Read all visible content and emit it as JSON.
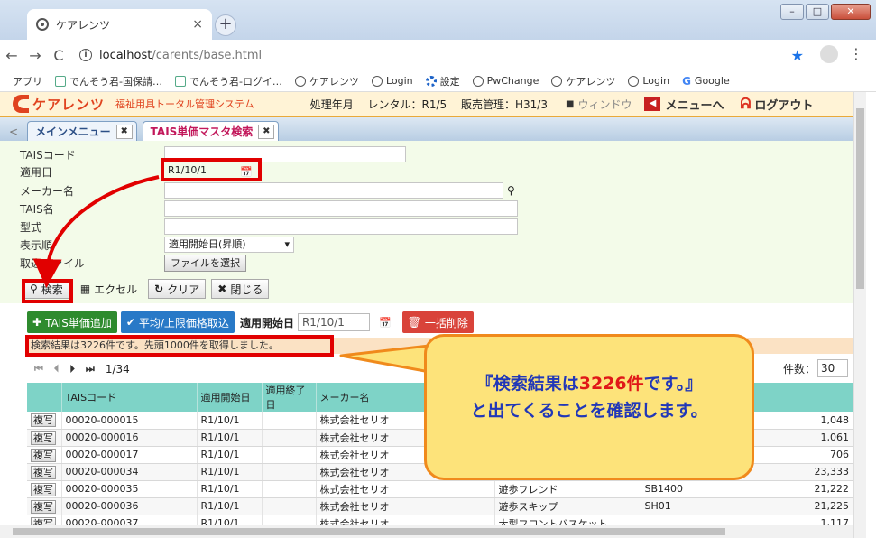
{
  "browser": {
    "tab_title": "ケアレンツ",
    "tab_close": "×",
    "new_tab": "+",
    "url_host": "localhost",
    "url_path": "/carents/base.html",
    "info_glyph": "i",
    "nav_back": "←",
    "nav_forward": "→",
    "nav_reload": "C",
    "bookmarks": [
      {
        "label": "アプリ",
        "icon": "apps-grid-icon"
      },
      {
        "label": "でんそう君-国保請…",
        "icon": "page-icon"
      },
      {
        "label": "でんそう君-ログイ…",
        "icon": "page-icon"
      },
      {
        "label": "ケアレンツ",
        "icon": "globe-icon"
      },
      {
        "label": "Login",
        "icon": "globe-icon"
      },
      {
        "label": "設定",
        "icon": "gear-icon"
      },
      {
        "label": "PwChange",
        "icon": "globe-icon"
      },
      {
        "label": "ケアレンツ",
        "icon": "globe-icon"
      },
      {
        "label": "Login",
        "icon": "globe-icon"
      },
      {
        "label": "Google",
        "icon": "google-icon"
      }
    ]
  },
  "app": {
    "logo_text": "ケアレンツ",
    "subtitle": "福祉用具トータル管理システム",
    "processing_label": "処理年月",
    "rental_label": "レンタル：R1/5",
    "sales_label": "販売管理：H31/3",
    "window_label": "ウィンドウ",
    "menu_label": "メニューへ",
    "logout_label": "ログアウト"
  },
  "tabs": [
    {
      "label": "メインメニュー",
      "active": false
    },
    {
      "label": "TAIS単価マスタ検索",
      "active": true
    }
  ],
  "form": {
    "tais_code_label": "TAISコード",
    "apply_date_label": "適用日",
    "apply_date_value": "R1/10/1",
    "maker_label": "メーカー名",
    "tais_name_label": "TAIS名",
    "model_label": "型式",
    "order_label": "表示順",
    "order_value": "適用開始日(昇順)",
    "import_label": "取込ファイル",
    "file_button": "ファイルを選択"
  },
  "toolbar": {
    "search": "検索",
    "excel": "エクセル",
    "clear": "クリア",
    "close": "閉じる"
  },
  "actions": {
    "add": "TAIS単価追加",
    "avg": "平均/上限価格取込",
    "start_label": "適用開始日",
    "start_value": "R1/10/1",
    "delete_all": "一括削除"
  },
  "result_message": "検索結果は3226件です。先頭1000件を取得しました。",
  "pager": {
    "page": "1/34",
    "per_page_label": "件数：",
    "per_page_value": "30"
  },
  "table": {
    "headers": [
      "",
      "TAISコード",
      "適用開始日",
      "適用終了日",
      "メーカー名",
      "",
      "",
      ""
    ],
    "copy_label": "複写",
    "rows": [
      {
        "code": "00020-000015",
        "start": "R1/10/1",
        "end": "",
        "maker": "株式会社セリオ",
        "name": "",
        "model": "",
        "price": "1,048"
      },
      {
        "code": "00020-000016",
        "start": "R1/10/1",
        "end": "",
        "maker": "株式会社セリオ",
        "name": "",
        "model": "",
        "price": "1,061"
      },
      {
        "code": "00020-000017",
        "start": "R1/10/1",
        "end": "",
        "maker": "株式会社セリオ",
        "name": "",
        "model": "",
        "price": "706"
      },
      {
        "code": "00020-000034",
        "start": "R1/10/1",
        "end": "",
        "maker": "株式会社セリオ",
        "name": "",
        "model": "",
        "price": "23,333"
      },
      {
        "code": "00020-000035",
        "start": "R1/10/1",
        "end": "",
        "maker": "株式会社セリオ",
        "name": "遊歩フレンド",
        "model": "SB1400",
        "price": "21,222"
      },
      {
        "code": "00020-000036",
        "start": "R1/10/1",
        "end": "",
        "maker": "株式会社セリオ",
        "name": "遊歩スキップ",
        "model": "SH01",
        "price": "21,225"
      },
      {
        "code": "00020-000037",
        "start": "R1/10/1",
        "end": "",
        "maker": "株式会社セリオ",
        "name": "大型フロントバスケット",
        "model": "",
        "price": "1,117"
      }
    ]
  },
  "callout": {
    "line1_pre": "『検索結果は",
    "line1_count": "3226件",
    "line1_post": "です。』",
    "line2": "と出てくることを確認します。"
  },
  "colors": {
    "highlight": "#e10000",
    "callout_fill": "#fde37a",
    "callout_border": "#f08a1c",
    "callout_text": "#2137b8"
  }
}
